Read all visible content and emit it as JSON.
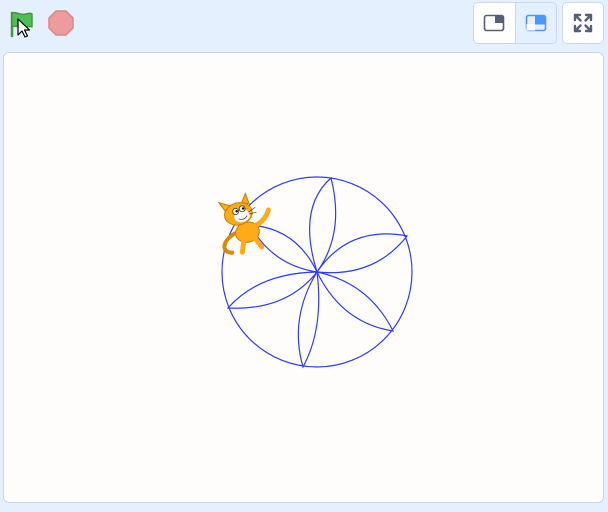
{
  "toolbar": {
    "green_flag": {
      "icon": "green-flag-icon",
      "color": "#4cbf56"
    },
    "stop": {
      "icon": "stop-icon",
      "color": "#ec9c9c"
    }
  },
  "stage_modes": {
    "small_stage": {
      "icon": "small-stage-icon",
      "active": false
    },
    "normal_stage": {
      "icon": "normal-stage-icon",
      "active": true,
      "accent": "#4c97ff"
    }
  },
  "fullscreen": {
    "icon": "fullscreen-icon"
  },
  "stage": {
    "sprite": {
      "name": "cat-sprite",
      "color": "#ffab19"
    },
    "pen_drawing": {
      "color": "#2b3bff",
      "shape": "circle with six petal arcs"
    }
  }
}
